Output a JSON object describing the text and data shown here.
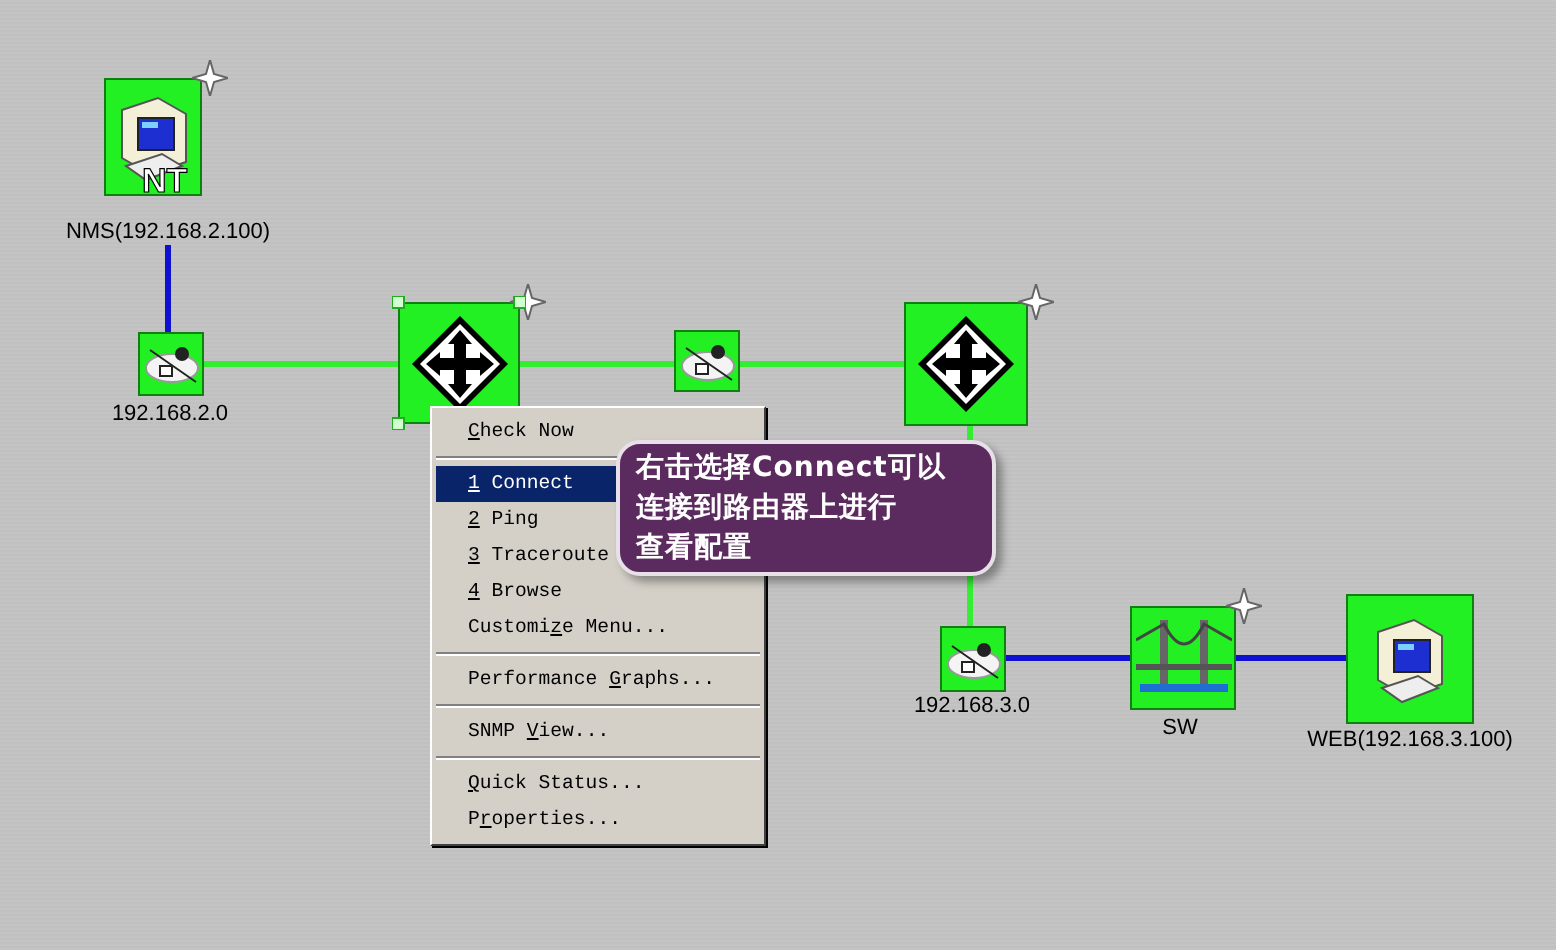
{
  "nodes": [
    {
      "kind": "nt-computer",
      "label": "NMS(192.168.2.100)",
      "badge": "NT",
      "star": true,
      "selected": false
    },
    {
      "kind": "network",
      "label": "192.168.2.0",
      "star": false,
      "selected": false
    },
    {
      "kind": "router",
      "star": true,
      "selected": true
    },
    {
      "kind": "network",
      "star": false,
      "selected": false
    },
    {
      "kind": "router",
      "star": true,
      "selected": false
    },
    {
      "kind": "network",
      "label": "192.168.3.0",
      "star": false,
      "selected": false
    },
    {
      "kind": "bridge",
      "label": "SW",
      "star": true,
      "selected": false
    },
    {
      "kind": "computer",
      "label": "WEB(192.168.3.100)",
      "star": false,
      "selected": false
    }
  ],
  "links": [
    {
      "color": "#1010d0"
    },
    {
      "color": "#33ee33"
    },
    {
      "color": "#33ee33"
    },
    {
      "color": "#33ee33"
    },
    {
      "color": "#33ee33"
    },
    {
      "color": "#1010d0"
    },
    {
      "color": "#1010d0"
    }
  ],
  "context_menu": [
    {
      "kind": "item",
      "key": "C",
      "after": "heck Now",
      "selected": false
    },
    {
      "kind": "separator"
    },
    {
      "kind": "item",
      "key": "1",
      "after": " Connect",
      "selected": true
    },
    {
      "kind": "item",
      "key": "2",
      "after": " Ping",
      "selected": false
    },
    {
      "kind": "item",
      "key": "3",
      "after": " Traceroute",
      "selected": false
    },
    {
      "kind": "item",
      "key": "4",
      "after": " Browse",
      "selected": false
    },
    {
      "kind": "item",
      "before": "Customi",
      "key": "z",
      "after": "e Menu...",
      "selected": false
    },
    {
      "kind": "separator"
    },
    {
      "kind": "item",
      "before": "Performance ",
      "key": "G",
      "after": "raphs...",
      "selected": false
    },
    {
      "kind": "separator"
    },
    {
      "kind": "item",
      "before": "SNMP ",
      "key": "V",
      "after": "iew...",
      "selected": false
    },
    {
      "kind": "separator"
    },
    {
      "kind": "item",
      "key": "Q",
      "after": "uick Status...",
      "selected": false
    },
    {
      "kind": "item",
      "before": "P",
      "key": "r",
      "after": "operties...",
      "selected": false
    }
  ],
  "callout": {
    "lines": [
      "右击选择Connect可以",
      "连接到路由器上进行",
      "查看配置"
    ]
  }
}
